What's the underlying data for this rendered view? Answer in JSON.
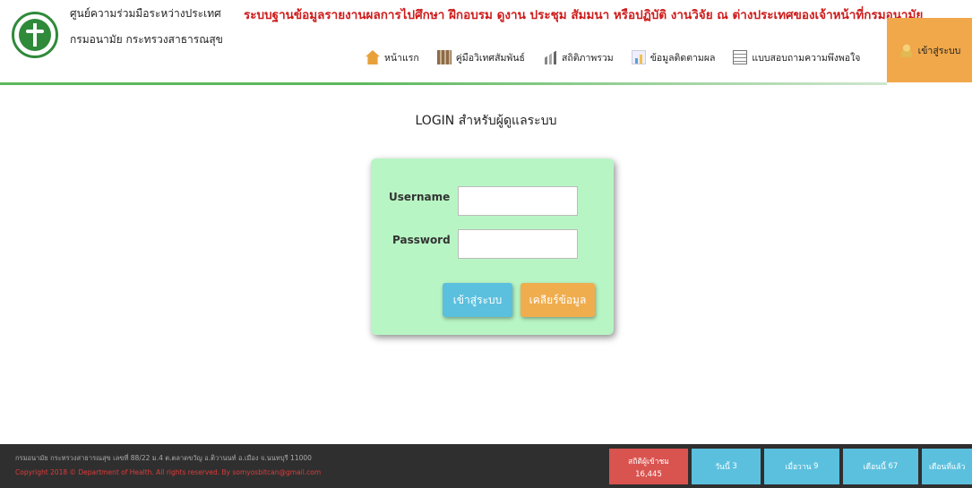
{
  "header": {
    "org_name_line1": "ศูนย์ความร่วมมือระหว่างประเทศ",
    "org_name_line2": "กรมอนามัย กระทรวงสาธารณสุข",
    "site_title": "ระบบฐานข้อมูลรายงานผลการไปศึกษา ฝึกอบรม ดูงาน ประชุม สัมมนา หรือปฏิบัติ งานวิจัย ณ ต่างประเทศของเจ้าหน้าที่กรมอนามัย",
    "logo_icon": "department-of-health-logo",
    "accent_color": "#5cb85c"
  },
  "nav": {
    "items": [
      {
        "label": "หน้าแรก",
        "icon": "home-icon"
      },
      {
        "label": "คู่มือวิเทศสัมพันธ์",
        "icon": "book-icon"
      },
      {
        "label": "สถิติภาพรวม",
        "icon": "chart-icon"
      },
      {
        "label": "ข้อมูลติดตามผล",
        "icon": "report-icon"
      },
      {
        "label": "แบบสอบถามความพึงพอใจ",
        "icon": "survey-icon"
      }
    ],
    "login_tab": {
      "label": "เข้าสู่ระบบ",
      "icon": "user-icon",
      "color": "#f0a84a"
    }
  },
  "main": {
    "title": "LOGIN สำหรับผู้ดูแลระบบ",
    "form": {
      "username_label": "Username",
      "username_value": "",
      "password_label": "Password",
      "password_value": "",
      "login_button": "เข้าสู่ระบบ",
      "clear_button": "เคลียร์ข้อมูล",
      "card_color": "#b8f5c4"
    }
  },
  "footer": {
    "address": "กรมอนามัย กระทรวงสาธารณสุข เลขที่ 88/22 ม.4 ต.ตลาดขวัญ อ.ติวานนท์ อ.เมือง จ.นนทบุรี 11000",
    "copyright": "Copyright 2018 © Department of Health. All rights reserved. By",
    "email": "somyosbitcan@gmail.com",
    "stats": {
      "total_label": "สถิติผู้เข้าชม",
      "total_value": "16,445",
      "today_label": "วันนี้",
      "today_value": "3",
      "yesterday_label": "เมื่อวาน",
      "yesterday_value": "9",
      "this_month_label": "เดือนนี้",
      "this_month_value": "67",
      "last_month_label": "เดือนที่แล้ว"
    }
  }
}
